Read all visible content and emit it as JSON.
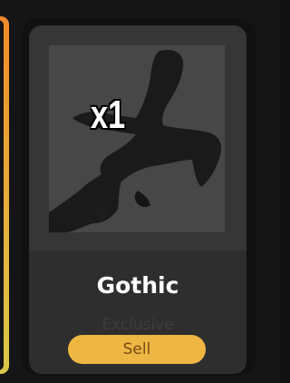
{
  "item": {
    "quantity": "x1",
    "name": "Gothic",
    "rarity": "Exclusive",
    "sell_label": "Sell",
    "icon": "gothic-figure-icon"
  },
  "colors": {
    "card_background": "#2e2e2e",
    "sell_button": "#eeb744",
    "sell_text": "#7a4b14",
    "side_card_accent": "#f08a2c"
  }
}
